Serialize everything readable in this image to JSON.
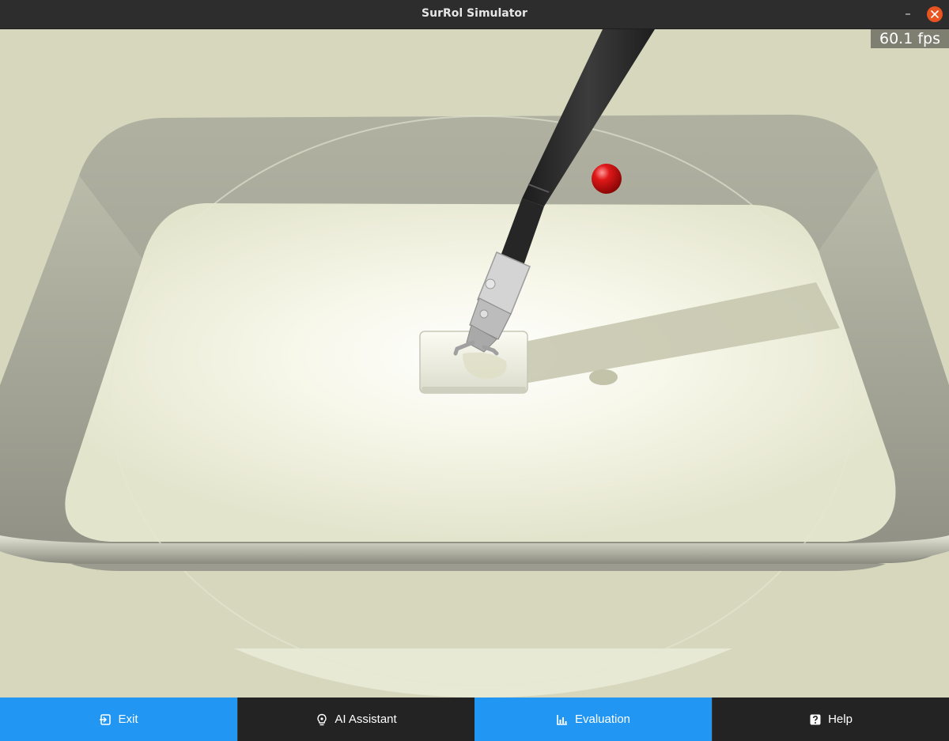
{
  "window": {
    "title": "SurRol Simulator",
    "minimize_glyph": "–",
    "close_icon": "close-icon"
  },
  "viewport": {
    "fps_text": "60.1 fps",
    "colors": {
      "background": "#d6d7bd",
      "tray": "#a8a89a",
      "tray_floor": "#f4f4e6",
      "instrument_shaft": "#2c2c2c",
      "target_sphere": "#d01515"
    }
  },
  "toolbar": {
    "buttons": [
      {
        "label": "Exit",
        "icon": "exit-icon",
        "style": "accent"
      },
      {
        "label": "AI Assistant",
        "icon": "bulb-icon",
        "style": "dark"
      },
      {
        "label": "Evaluation",
        "icon": "chart-icon",
        "style": "accent"
      },
      {
        "label": "Help",
        "icon": "help-icon",
        "style": "dark"
      }
    ],
    "colors": {
      "accent": "#2196f3",
      "dark": "#232323"
    }
  }
}
